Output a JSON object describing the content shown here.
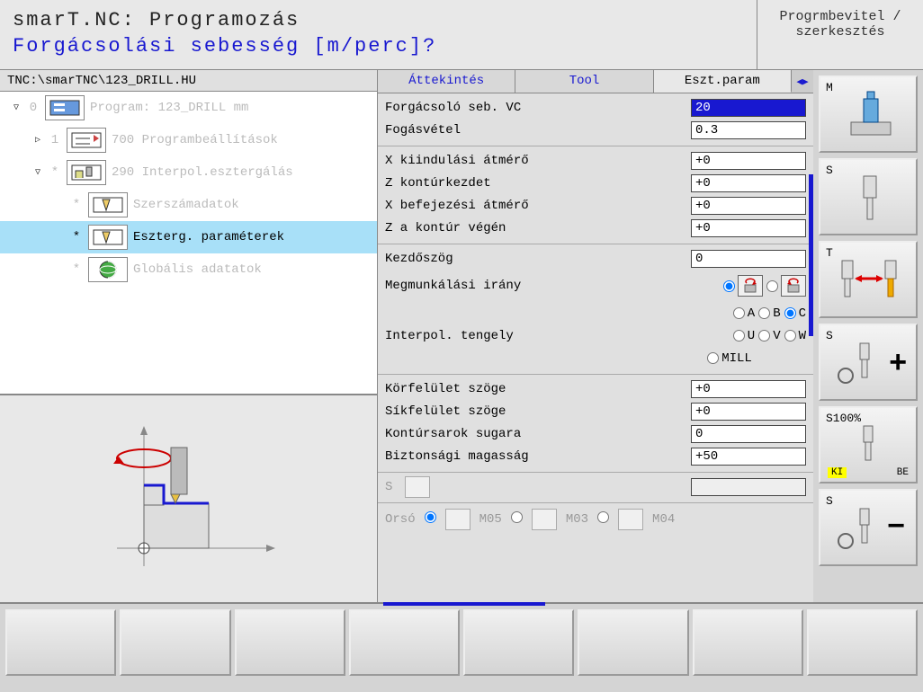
{
  "header": {
    "title": "smarT.NC: Programozás",
    "subtitle": "Forgácsolási sebesség [m/perc]?",
    "mode": "Progrmbevitel / szerkesztés"
  },
  "path": "TNC:\\smarTNC\\123_DRILL.HU",
  "tree": [
    {
      "toggle": "▽",
      "num": "0",
      "label": "Program: 123_DRILL mm",
      "indent": 0
    },
    {
      "toggle": "▷",
      "num": "1",
      "label": "700 Programbeállítások",
      "indent": 1
    },
    {
      "toggle": "▽",
      "num": "*",
      "label": "290 Interpol.esztergálás",
      "indent": 1
    },
    {
      "toggle": "",
      "num": "*",
      "label": "Szerszámadatok",
      "indent": 2
    },
    {
      "toggle": "",
      "num": "*",
      "label": "Eszterg. paraméterek",
      "indent": 2,
      "selected": true
    },
    {
      "toggle": "",
      "num": "*",
      "label": "Globális adatatok",
      "indent": 2
    }
  ],
  "tabs": {
    "t1": "Áttekintés",
    "t2": "Tool",
    "t3": "Eszt.param"
  },
  "params": {
    "vc_label": "Forgácsoló seb. VC",
    "vc": "20",
    "feed_label": "Fogásvétel",
    "feed": "0.3",
    "xstart_label": "X kiindulási átmérő",
    "xstart": "+0",
    "zstart_label": "Z kontúrkezdet",
    "zstart": "+0",
    "xend_label": "X befejezési átmérő",
    "xend": "+0",
    "zend_label": "Z a kontúr végén",
    "zend": "+0",
    "startang_label": "Kezdőszög",
    "startang": "0",
    "dir_label": "Megmunkálási irány",
    "axis_label": "Interpol. tengely",
    "opt_a": "A",
    "opt_b": "B",
    "opt_c": "C",
    "opt_u": "U",
    "opt_v": "V",
    "opt_w": "W",
    "opt_mill": "MILL",
    "circ_label": "Körfelület szöge",
    "circ": "+0",
    "flat_label": "Síkfelület szöge",
    "flat": "+0",
    "corner_label": "Kontúrsarok sugara",
    "corner": "0",
    "safe_label": "Biztonsági magasság",
    "safe": "+50",
    "s_label": "S",
    "spindle_label": "Orsó",
    "m05": "M05",
    "m03": "M03",
    "m04": "M04"
  },
  "side": {
    "m": "M",
    "s": "S",
    "t": "T",
    "s2": "S",
    "s100": "S100%",
    "ki": "KI",
    "be": "BE",
    "s3": "S"
  }
}
